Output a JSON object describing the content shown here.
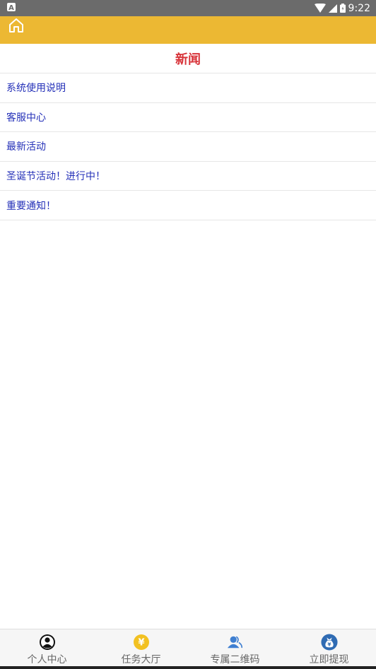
{
  "status_bar": {
    "time": "9:22",
    "left_icon": "a-notification-icon",
    "icons": [
      "wifi-icon",
      "cell-signal-icon",
      "battery-icon"
    ]
  },
  "header": {
    "home_icon": "home-icon",
    "bg_color": "#ecb833"
  },
  "page": {
    "title": "新闻",
    "title_color": "#d8343a"
  },
  "news": {
    "link_color": "#2430b8",
    "items": [
      {
        "label": "系统使用说明"
      },
      {
        "label": "客服中心"
      },
      {
        "label": "最新活动"
      },
      {
        "label": "圣诞节活动！进行中！"
      },
      {
        "label": "重要通知！"
      }
    ]
  },
  "bottom_nav": {
    "items": [
      {
        "label": "个人中心",
        "icon": "user-icon"
      },
      {
        "label": "任务大厅",
        "icon": "yuan-coin-icon"
      },
      {
        "label": "专属二维码",
        "icon": "people-icon"
      },
      {
        "label": "立即提现",
        "icon": "money-bag-icon"
      }
    ]
  }
}
